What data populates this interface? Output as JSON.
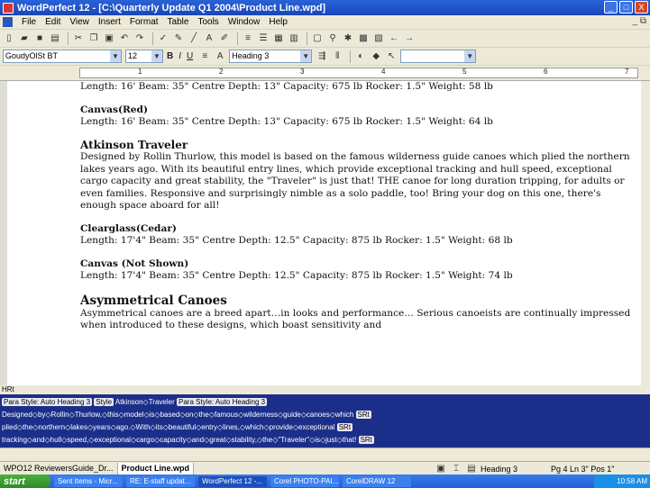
{
  "window": {
    "title": "WordPerfect 12 - [C:\\Quarterly Update Q1 2004\\Product Line.wpd]",
    "minimize": "_",
    "maximize": "□",
    "close": "X"
  },
  "menu": {
    "items": [
      "File",
      "Edit",
      "View",
      "Insert",
      "Format",
      "Table",
      "Tools",
      "Window",
      "Help"
    ],
    "right": "_ ⧉"
  },
  "property_bar": {
    "font": "GoudyOlSt BT",
    "size": "12",
    "bold": "B",
    "italic": "I",
    "underline": "U",
    "style": "Heading 3"
  },
  "ruler": {
    "numbers": [
      "1",
      "2",
      "3",
      "4",
      "5",
      "6",
      "7"
    ]
  },
  "document": {
    "lines": [
      "Length: 16' Beam: 35\" Centre Depth: 13\" Capacity: 675 lb Rocker: 1.5\" Weight: 58 lb",
      "Canvas(Red)",
      "Length: 16' Beam: 35\" Centre Depth: 13\" Capacity: 675 lb Rocker: 1.5\" Weight: 64 lb",
      "Atkinson Traveler",
      "Designed by Rollin Thurlow, this model is based on the famous wilderness guide canoes which plied the northern lakes years ago. With its beautiful entry lines, which provide exceptional tracking and hull speed, exceptional cargo capacity and great stability, the \"Traveler\" is just that! THE canoe for long duration tripping, for adults or even families. Responsive and surprisingly nimble as a solo paddle, too! Bring your dog on this one, there's enough space aboard for all!",
      "Clearglass(Cedar)",
      "Length: 17'4\" Beam: 35\" Centre Depth: 12.5\" Capacity: 875 lb Rocker: 1.5\" Weight: 68 lb",
      "Canvas (Not Shown)",
      "Length: 17'4\" Beam: 35\" Centre Depth: 12.5\" Capacity: 875 lb Rocker: 1.5\" Weight: 74 lb",
      "Asymmetrical Canoes",
      "Asymmetrical canoes are a breed apart…in looks and performance… Serious canoeists are continually impressed when introduced to these designs, which boast sensitivity and"
    ]
  },
  "reveal_codes": {
    "header": "HRt",
    "line1_a": "Para Style: Auto Heading 3",
    "line1_b": "Style",
    "line1_c": "Atkinson◇Traveler",
    "line1_d": "Para Style: Auto Heading 3",
    "line2": "Designed◇by◇Rollin◇Thurlow,◇this◇model◇is◇based◇on◇the◇famous◇wilderness◇guide◇canoes◇which",
    "line3": "plied◇the◇northern◇lakes◇years◇ago.◇With◇its◇beautiful◇entry◇lines,◇which◇provide◇exceptional",
    "line4": "tracking◇and◇hull◇speed,◇exceptional◇cargo◇capacity◇and◇great◇stability,◇the◇\"Traveler\"◇is◇just◇that!",
    "srt": "SRt"
  },
  "status": {
    "tabs": [
      "WPO12 ReviewersGuide_Dr...",
      "Product Line.wpd"
    ],
    "style": "Heading 3",
    "position": "Pg 4 Ln 3\" Pos 1\""
  },
  "taskbar": {
    "start": "start",
    "tasks": [
      "Sent Items - Micr...",
      "RE: E-staff updat...",
      "WordPerfect 12 -...",
      "Corel PHOTO-PAI...",
      "CorelDRAW 12"
    ],
    "clock": "10:58 AM"
  }
}
